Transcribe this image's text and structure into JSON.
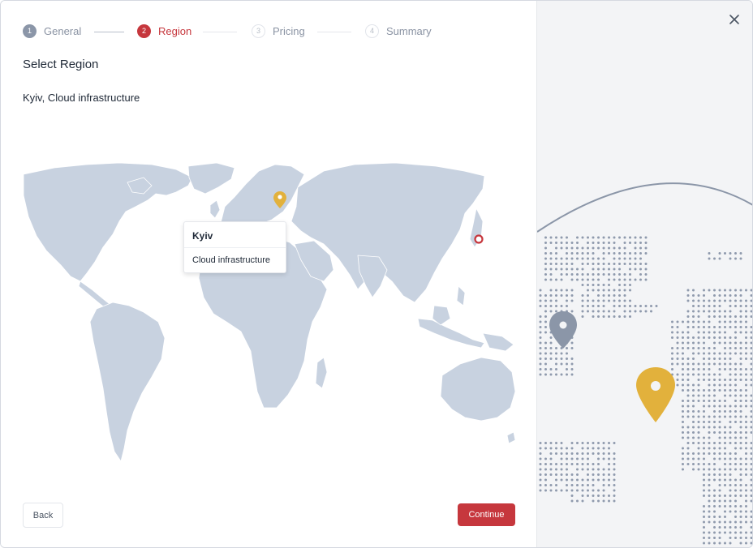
{
  "stepper": {
    "steps": [
      {
        "num": "1",
        "label": "General",
        "state": "done"
      },
      {
        "num": "2",
        "label": "Region",
        "state": "active"
      },
      {
        "num": "3",
        "label": "Pricing",
        "state": "todo"
      },
      {
        "num": "4",
        "label": "Summary",
        "state": "todo"
      }
    ]
  },
  "page": {
    "title": "Select Region",
    "selected": "Kyiv, Cloud infrastructure"
  },
  "tooltip": {
    "city": "Kyiv",
    "description": "Cloud infrastructure"
  },
  "footer": {
    "back_label": "Back",
    "continue_label": "Continue"
  },
  "icons": {
    "close": "close-icon",
    "marker_selected": "map-pin-icon",
    "marker_other": "map-pin-icon"
  },
  "colors": {
    "accent": "#c6373d",
    "selected_pin": "#e2b13c",
    "inactive_step": "#8b96a8",
    "land": "#c8d2e0"
  }
}
